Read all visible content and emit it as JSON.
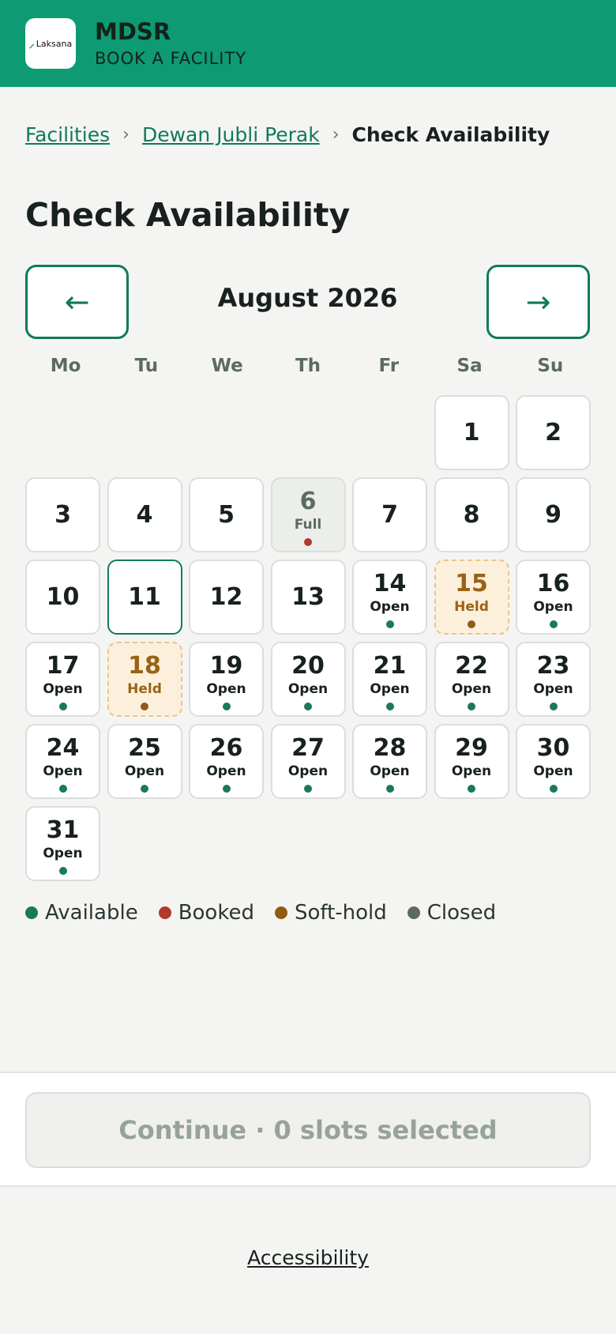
{
  "header": {
    "logo_text": "Laksana",
    "app_name": "MDSR",
    "subtitle": "BOOK A FACILITY"
  },
  "breadcrumb": {
    "items": [
      "Facilities",
      "Dewan Jubli Perak"
    ],
    "current": "Check Availability",
    "separator": "›"
  },
  "page_title": "Check Availability",
  "calendar": {
    "month_label": "August 2026",
    "prev_icon": "←",
    "next_icon": "→",
    "weekdays": [
      "Mo",
      "Tu",
      "We",
      "Th",
      "Fr",
      "Sa",
      "Su"
    ],
    "leading_blanks": 5,
    "today": 11,
    "days": [
      {
        "num": "1",
        "status": ""
      },
      {
        "num": "2",
        "status": ""
      },
      {
        "num": "3",
        "status": ""
      },
      {
        "num": "4",
        "status": ""
      },
      {
        "num": "5",
        "status": ""
      },
      {
        "num": "6",
        "status": "Full",
        "state": "booked"
      },
      {
        "num": "7",
        "status": ""
      },
      {
        "num": "8",
        "status": ""
      },
      {
        "num": "9",
        "status": ""
      },
      {
        "num": "10",
        "status": ""
      },
      {
        "num": "11",
        "status": ""
      },
      {
        "num": "12",
        "status": ""
      },
      {
        "num": "13",
        "status": ""
      },
      {
        "num": "14",
        "status": "Open",
        "state": "available"
      },
      {
        "num": "15",
        "status": "Held",
        "state": "hold"
      },
      {
        "num": "16",
        "status": "Open",
        "state": "available"
      },
      {
        "num": "17",
        "status": "Open",
        "state": "available"
      },
      {
        "num": "18",
        "status": "Held",
        "state": "hold"
      },
      {
        "num": "19",
        "status": "Open",
        "state": "available"
      },
      {
        "num": "20",
        "status": "Open",
        "state": "available"
      },
      {
        "num": "21",
        "status": "Open",
        "state": "available"
      },
      {
        "num": "22",
        "status": "Open",
        "state": "available"
      },
      {
        "num": "23",
        "status": "Open",
        "state": "available"
      },
      {
        "num": "24",
        "status": "Open",
        "state": "available"
      },
      {
        "num": "25",
        "status": "Open",
        "state": "available"
      },
      {
        "num": "26",
        "status": "Open",
        "state": "available"
      },
      {
        "num": "27",
        "status": "Open",
        "state": "available"
      },
      {
        "num": "28",
        "status": "Open",
        "state": "available"
      },
      {
        "num": "29",
        "status": "Open",
        "state": "available"
      },
      {
        "num": "30",
        "status": "Open",
        "state": "available"
      },
      {
        "num": "31",
        "status": "Open",
        "state": "available"
      }
    ]
  },
  "legend": [
    {
      "label": "Available",
      "color": "#1a7a55"
    },
    {
      "label": "Booked",
      "color": "#b03a2e"
    },
    {
      "label": "Soft-hold",
      "color": "#8f5c14"
    },
    {
      "label": "Closed",
      "color": "#5d6a64"
    }
  ],
  "colors": {
    "brand": "#0e9a73",
    "accent": "#0f7a5b",
    "available": "#1a7a55",
    "booked": "#b03a2e",
    "hold": "#8f5c14"
  },
  "continue_button": "Continue · 0 slots selected",
  "footer": {
    "accessibility_link": "Accessibility"
  }
}
